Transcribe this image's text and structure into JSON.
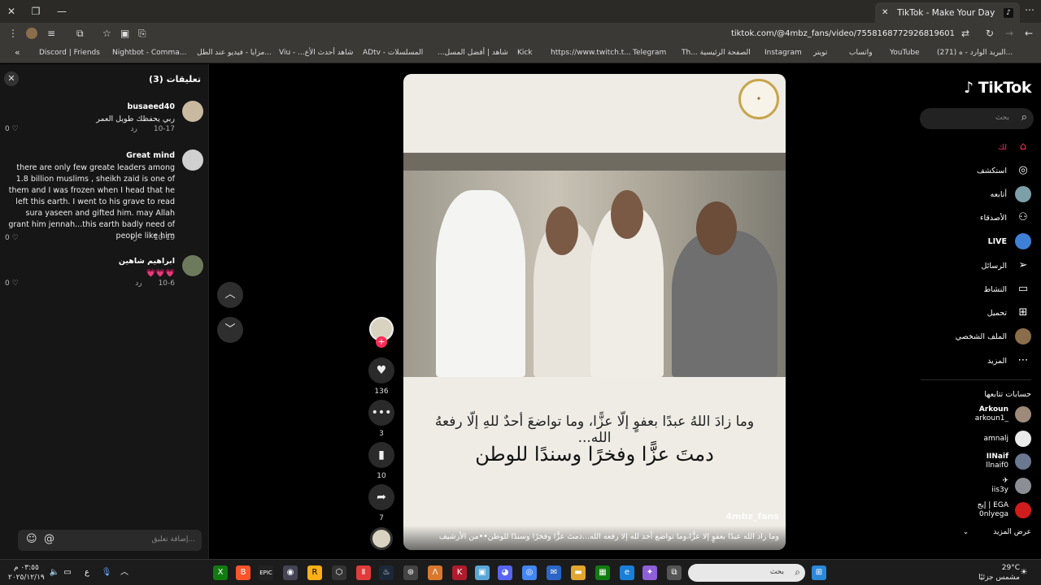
{
  "browser": {
    "tab_title": "TikTok - Make Your Day",
    "url": "tiktok.com/@4mbz_fans/video/7558168772926819601",
    "bookmarks": [
      "Discord | Friends",
      "Nightbot - Comma...",
      "مزايا - فيديو عند الطل...",
      "Viu - ...شاهد أحدث الأع",
      "ADtv - المسلسلات",
      "...شاهد | أفضل المسل",
      "Kick",
      "https://www.twitch.t...",
      "Telegram",
      "Th... الصفحة الرئيسية",
      "Instagram",
      "تويتر",
      "واتساب",
      "YouTube",
      "(271) البريد الوارد - ه..."
    ]
  },
  "comments_panel": {
    "title": "تعليقات (3)",
    "reply_label": "رد",
    "comments": [
      {
        "user": "busaeed40",
        "text": "ربي يحفظك طويل العمر",
        "date": "10-17",
        "likes": "0"
      },
      {
        "user": "Great mind",
        "text": "there are only few greate leaders among 1.8 billion muslims , sheikh zaid is one of them and I was frozen when I head that he left this earth. I went to his grave to read sura yaseen and gifted him. may Allah grant him jennah...this earth badly need of people like him",
        "date": "10-19",
        "likes": "0"
      },
      {
        "user": "ابراهيم شاهين",
        "text": "💗💗💗",
        "date": "10-6",
        "likes": "0"
      }
    ],
    "input_placeholder": "إضافة تعليق..."
  },
  "video": {
    "line1": "وما زادَ اللهُ عبدًا بعفوٍ إلّا عزًّا، وما تواضعَ أحدٌ للهِ إلّا رفعهُ الله...",
    "line2": "دمتَ عزًّا وفخرًا وسندًا للوطن",
    "watermark": "4mbz_fans",
    "caption": "وما زاد الله عبدًا بعفوٍ إلا عزًّا،وما تواضع أحد لله إلا رفعه الله...دمتَ عزًّا وفخرًا وسندًا للوطن••من الأرشيف"
  },
  "actions": {
    "likes": "136",
    "comments": "3",
    "saves": "10",
    "shares": "7"
  },
  "sidebar": {
    "logo": "TikTok",
    "search_placeholder": "بحث",
    "nav": [
      "لك",
      "استكشف",
      "أتابعه",
      "الأصدقاء",
      "LIVE",
      "الرسائل",
      "النشاط",
      "تحميل",
      "الملف الشخصي",
      "المزيد"
    ],
    "following_title": "حسابات تتابعها",
    "accounts": [
      {
        "name": "Arkoun",
        "handle": "arkoun1_"
      },
      {
        "name": "amnalj",
        "handle": ""
      },
      {
        "name": "IINaif",
        "handle": "llnaif0"
      },
      {
        "name": "✈",
        "handle": "iis3y"
      },
      {
        "name": "إيج | EGA",
        "handle": "0nlyega"
      }
    ],
    "see_more": "عرض المزيد"
  },
  "taskbar": {
    "search_placeholder": "بحث",
    "time": "٠٣:٥٥ م",
    "date": "٢٠٢٥/١٢/١٩",
    "temp": "29°C",
    "weather": "مشمس جزئيًا",
    "lang": "ع"
  },
  "colors": {
    "accent": "#fe2c55",
    "panel": "#161616",
    "seal": "#c7a54d"
  }
}
